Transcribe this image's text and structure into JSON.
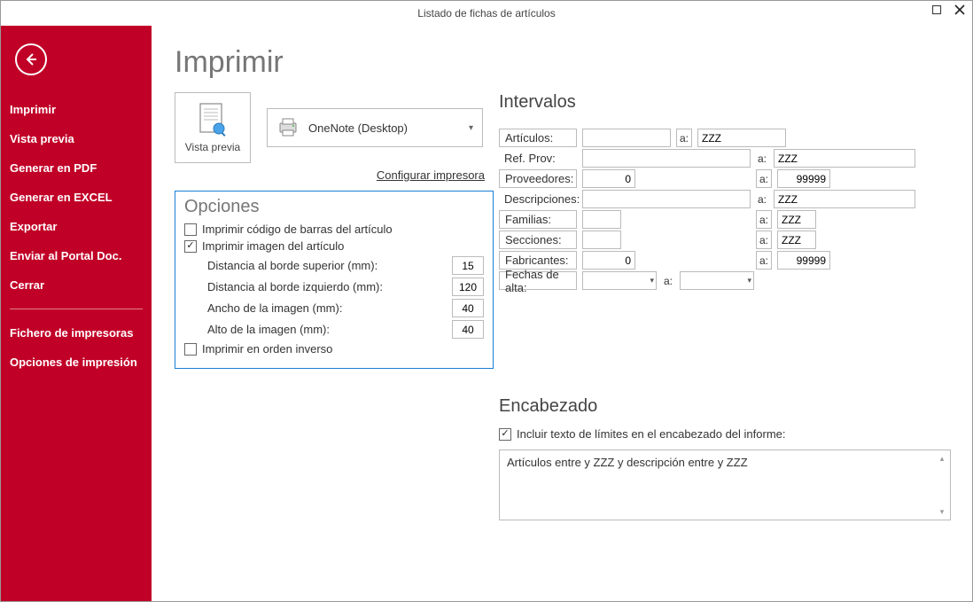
{
  "window": {
    "title": "Listado de fichas de artículos"
  },
  "sidebar": {
    "items": [
      "Imprimir",
      "Vista previa",
      "Generar en PDF",
      "Generar en EXCEL",
      "Exportar",
      "Enviar al Portal Doc.",
      "Cerrar"
    ],
    "items2": [
      "Fichero de impresoras",
      "Opciones de impresión"
    ]
  },
  "page": {
    "title": "Imprimir",
    "vista_previa": "Vista previa",
    "printer_selected": "OneNote (Desktop)",
    "config_link": "Configurar impresora"
  },
  "opciones": {
    "title": "Opciones",
    "chk_barras": "Imprimir código de barras del artículo",
    "chk_imagen": "Imprimir imagen del artículo",
    "dist_sup_label": "Distancia al borde superior (mm):",
    "dist_sup_val": "15",
    "dist_izq_label": "Distancia al borde izquierdo (mm):",
    "dist_izq_val": "120",
    "ancho_label": "Ancho de la imagen (mm):",
    "ancho_val": "40",
    "alto_label": "Alto de la imagen (mm):",
    "alto_val": "40",
    "chk_inverso": "Imprimir en orden inverso"
  },
  "intervalos": {
    "title": "Intervalos",
    "a": "a:",
    "rows": {
      "articulos": {
        "label": "Artículos:",
        "from": "",
        "to": "ZZZ"
      },
      "refprov": {
        "label": "Ref. Prov:",
        "from": "",
        "to": "ZZZ"
      },
      "prov": {
        "label": "Proveedores:",
        "from": "0",
        "to": "99999"
      },
      "desc": {
        "label": "Descripciones:",
        "from": "",
        "to": "ZZZ"
      },
      "fam": {
        "label": "Familias:",
        "from": "",
        "to": "ZZZ"
      },
      "sec": {
        "label": "Secciones:",
        "from": "",
        "to": "ZZZ"
      },
      "fab": {
        "label": "Fabricantes:",
        "from": "0",
        "to": "99999"
      },
      "fechas": {
        "label": "Fechas de alta:",
        "from": "",
        "to": ""
      }
    }
  },
  "encabezado": {
    "title": "Encabezado",
    "chk": "Incluir texto de límites en el encabezado del informe:",
    "text": "Artículos entre  y ZZZ y descripción entre  y ZZZ"
  }
}
